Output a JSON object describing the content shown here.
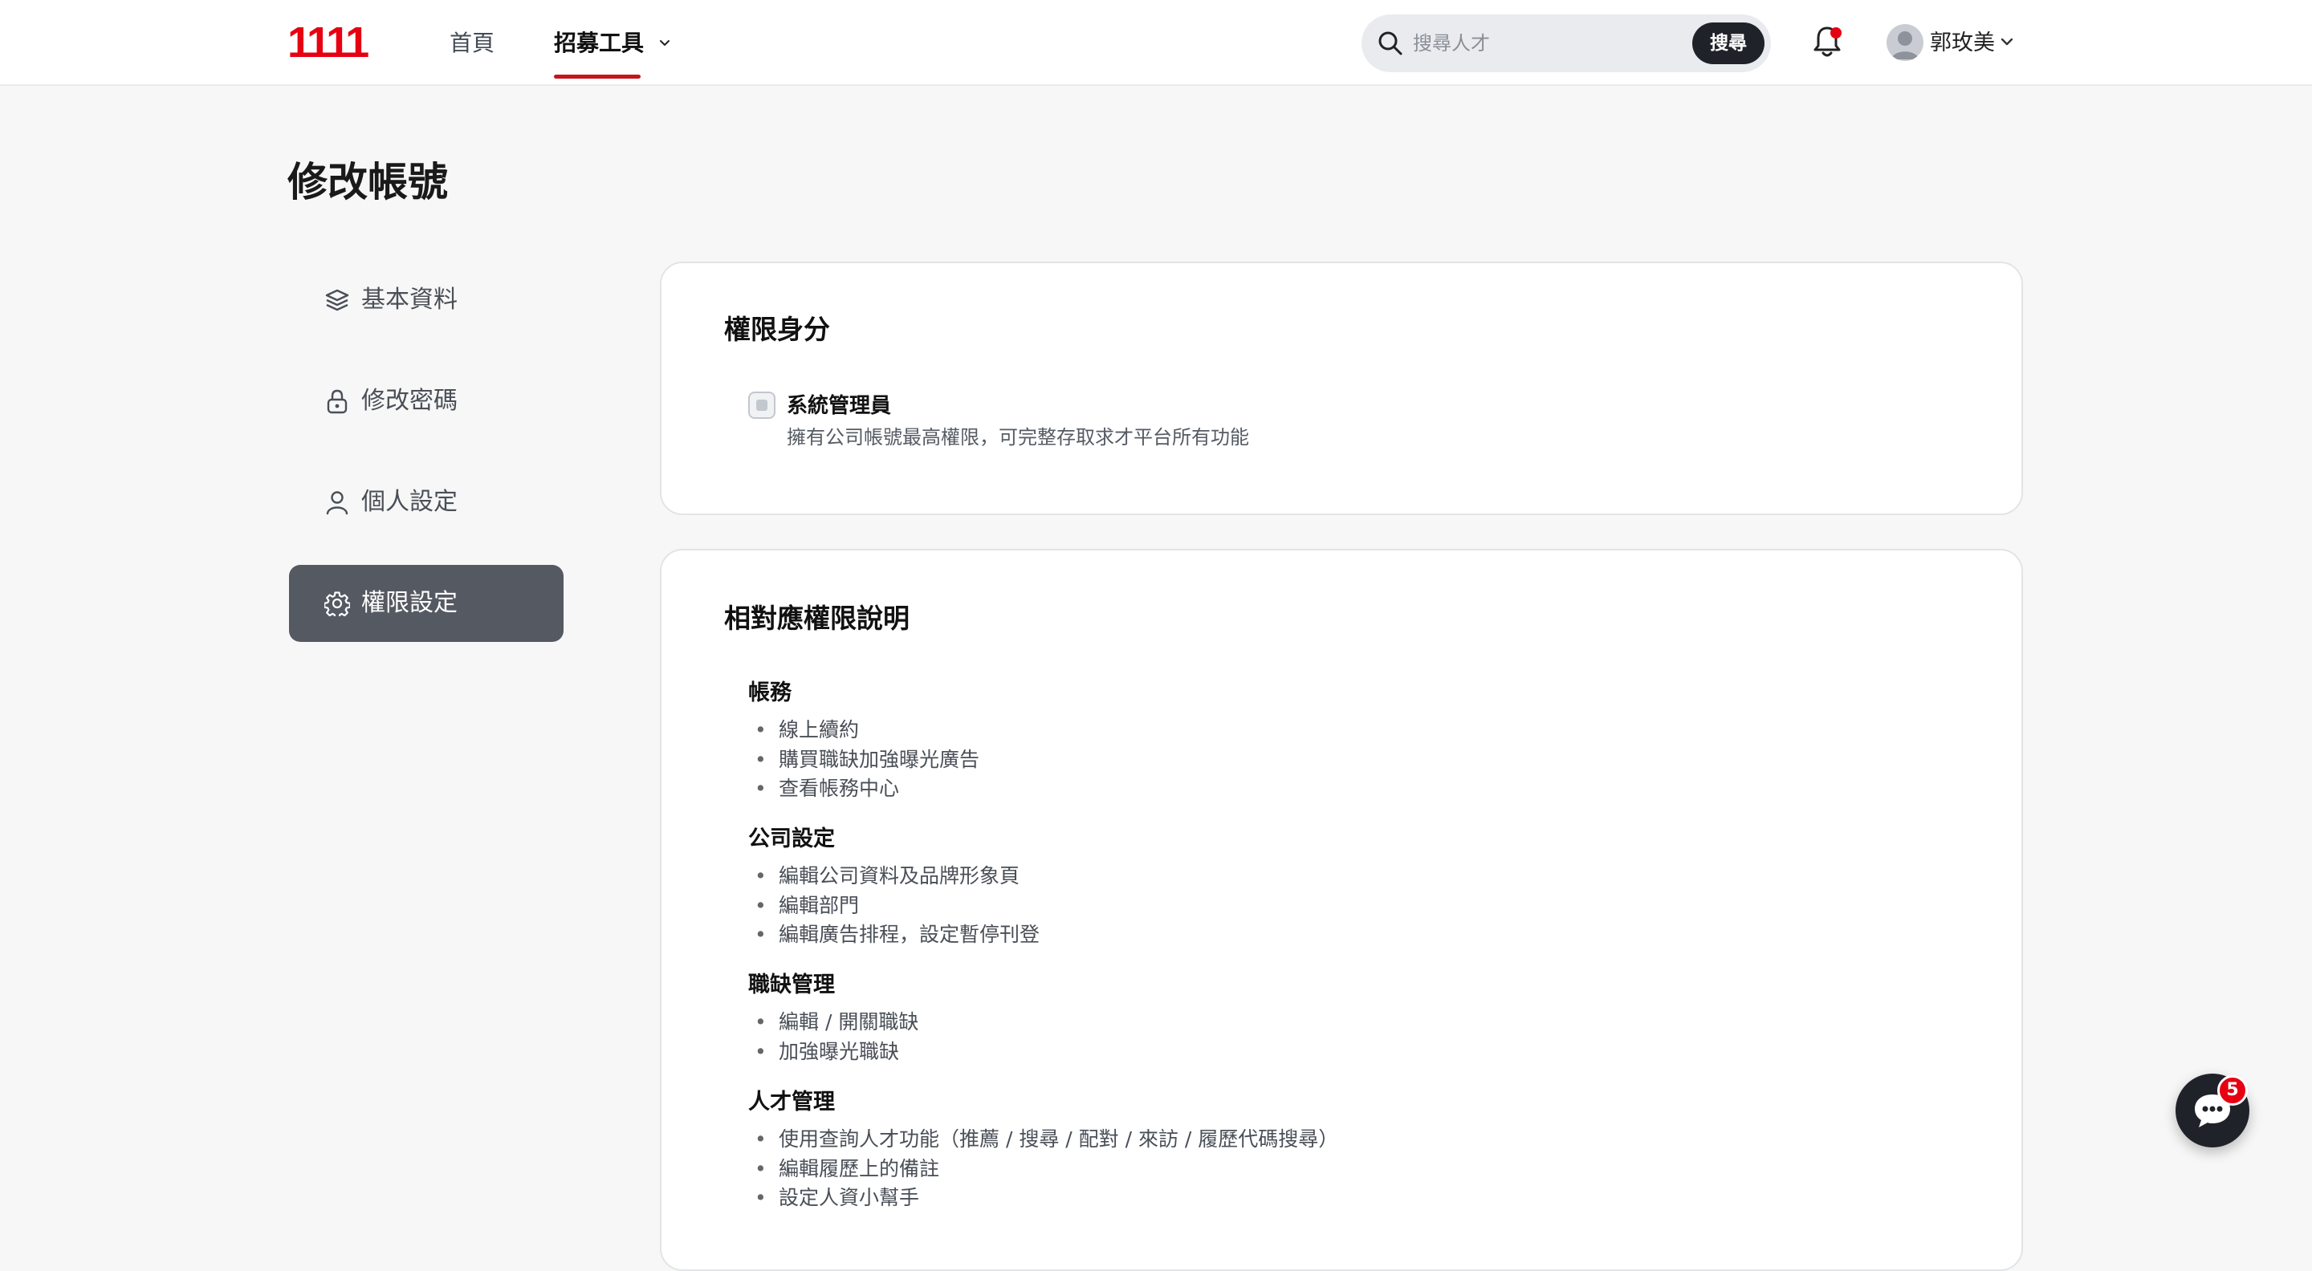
{
  "header": {
    "logo": "1111",
    "nav": {
      "home": "首頁",
      "tools": "招募工具"
    },
    "search": {
      "placeholder": "搜尋人才",
      "button": "搜尋"
    },
    "user": {
      "name": "郭玫美"
    }
  },
  "page": {
    "title": "修改帳號"
  },
  "sidebar": {
    "items": [
      {
        "label": "基本資料",
        "icon": "layers-icon"
      },
      {
        "label": "修改密碼",
        "icon": "lock-icon"
      },
      {
        "label": "個人設定",
        "icon": "user-icon"
      },
      {
        "label": "權限設定",
        "icon": "gear-icon",
        "active": true
      }
    ]
  },
  "role_card": {
    "title": "權限身分",
    "role_label": "系統管理員",
    "role_desc": "擁有公司帳號最高權限，可完整存取求才平台所有功能",
    "checked": false
  },
  "perm_card": {
    "title": "相對應權限說明",
    "groups": [
      {
        "heading": "帳務",
        "items": [
          "線上續約",
          "購買職缺加強曝光廣告",
          "查看帳務中心"
        ]
      },
      {
        "heading": "公司設定",
        "items": [
          "編輯公司資料及品牌形象頁",
          "編輯部門",
          "編輯廣告排程，設定暫停刊登"
        ]
      },
      {
        "heading": "職缺管理",
        "items": [
          "編輯 / 開關職缺",
          "加強曝光職缺"
        ]
      },
      {
        "heading": "人才管理",
        "items": [
          "使用查詢人才功能（推薦 / 搜尋 / 配對 / 來訪 / 履歷代碼搜尋）",
          "編輯履歷上的備註",
          "設定人資小幫手"
        ]
      }
    ]
  },
  "chat": {
    "badge": "5"
  },
  "colors": {
    "brand": "#e60012",
    "active_sidebar": "#545962",
    "dark_button": "#1f2329"
  }
}
